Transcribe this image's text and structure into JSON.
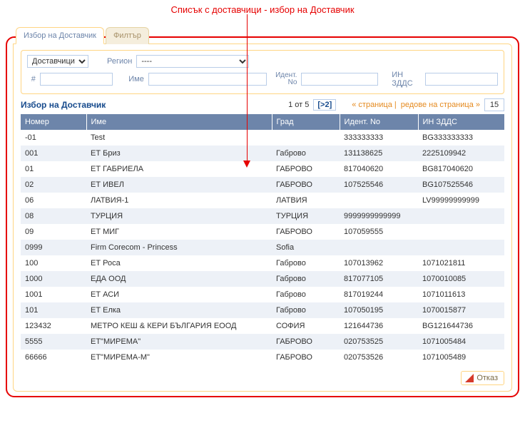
{
  "annotation": "Списък с доставчици - избор на Доставчик",
  "tabs": {
    "select": "Избор на Доставчик",
    "filter": "Филтър"
  },
  "filters": {
    "dropdown_main": "Доставчици",
    "region_label": "Регион",
    "region_value": "----",
    "num_label": "#",
    "name_label": "Име",
    "ident_label": "Идент. No",
    "vat_label": "ИН ЗДДС"
  },
  "toolbar": {
    "title": "Избор на Доставчик",
    "page_info": "1 от 5",
    "next_box": "[>2]",
    "left_nav": "« страница |",
    "right_nav": "редове на страница »",
    "rows_value": "15"
  },
  "columns": {
    "num": "Номер",
    "name": "Име",
    "city": "Град",
    "ident": "Идент. No",
    "vat": "ИН ЗДДС"
  },
  "rows": [
    {
      "num": "-01",
      "name": "Test",
      "city": "",
      "ident": "333333333",
      "vat": "BG333333333"
    },
    {
      "num": "001",
      "name": "ЕТ Бриз",
      "city": "Габрово",
      "ident": "131138625",
      "vat": "2225109942"
    },
    {
      "num": "01",
      "name": "ЕТ ГАБРИЕЛА",
      "city": "ГАБРОВО",
      "ident": "817040620",
      "vat": "BG817040620"
    },
    {
      "num": "02",
      "name": "ЕТ ИВЕЛ",
      "city": "ГАБРОВО",
      "ident": "107525546",
      "vat": "BG107525546"
    },
    {
      "num": "06",
      "name": "ЛАТВИЯ-1",
      "city": "ЛАТВИЯ",
      "ident": "",
      "vat": "LV99999999999"
    },
    {
      "num": "08",
      "name": "ТУРЦИЯ",
      "city": "ТУРЦИЯ",
      "ident": "9999999999999",
      "vat": ""
    },
    {
      "num": "09",
      "name": "ЕТ МИГ",
      "city": "ГАБРОВО",
      "ident": "107059555",
      "vat": ""
    },
    {
      "num": "0999",
      "name": "Firm Corecom - Princess",
      "city": "Sofia",
      "ident": "",
      "vat": ""
    },
    {
      "num": "100",
      "name": "ЕТ Роса",
      "city": "Габрово",
      "ident": "107013962",
      "vat": "1071021811"
    },
    {
      "num": "1000",
      "name": "ЕДА ООД",
      "city": "Габрово",
      "ident": "817077105",
      "vat": "1070010085"
    },
    {
      "num": "1001",
      "name": "ЕТ АСИ",
      "city": "Габрово",
      "ident": "817019244",
      "vat": "1071011613"
    },
    {
      "num": "101",
      "name": "ЕТ Елка",
      "city": "Габрово",
      "ident": "107050195",
      "vat": "1070015877"
    },
    {
      "num": "123432",
      "name": "МЕТРО КЕШ & КЕРИ БЪЛГАРИЯ ЕООД",
      "city": "СОФИЯ",
      "ident": "121644736",
      "vat": "BG121644736"
    },
    {
      "num": "5555",
      "name": "ЕТ\"МИРЕМА\"",
      "city": "ГАБРОВО",
      "ident": "020753525",
      "vat": "1071005484"
    },
    {
      "num": "66666",
      "name": "ЕТ\"МИРЕМА-М\"",
      "city": "ГАБРОВО",
      "ident": "020753526",
      "vat": "1071005489"
    }
  ],
  "buttons": {
    "cancel": "Отказ"
  }
}
